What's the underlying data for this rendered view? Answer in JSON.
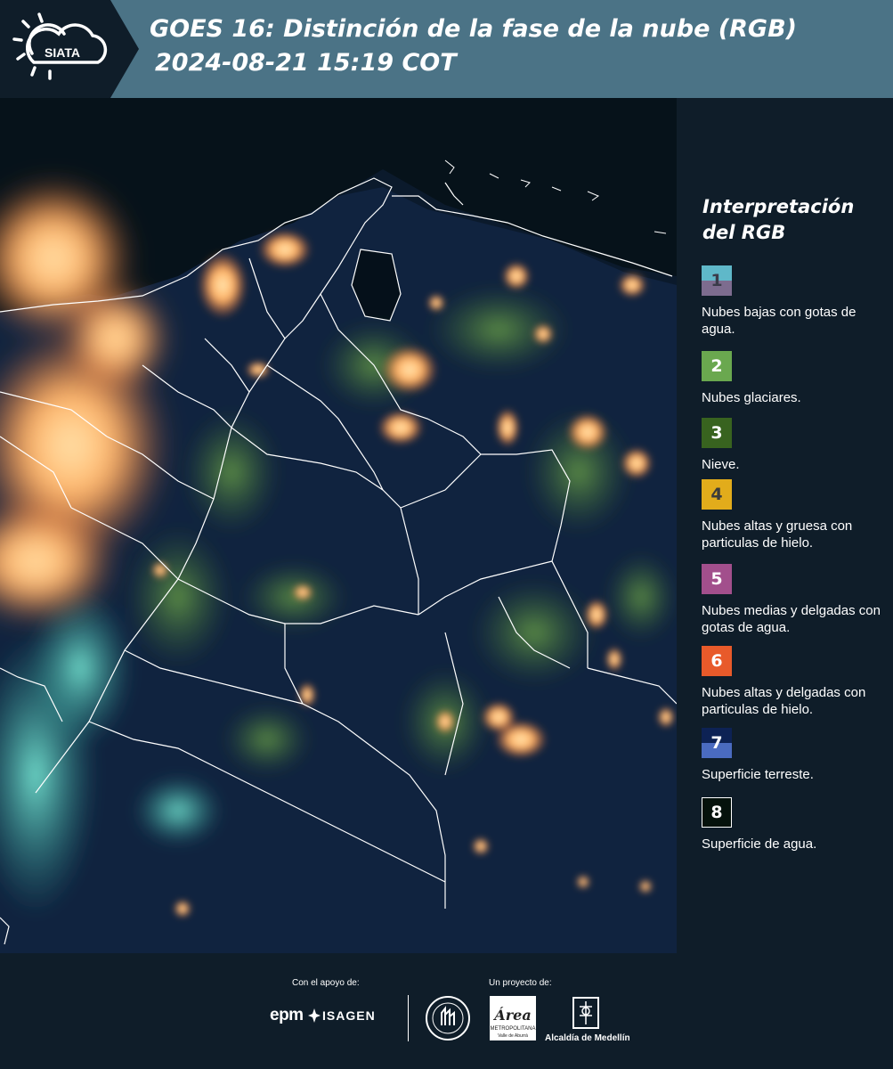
{
  "header": {
    "logo_text": "SIATA",
    "title_line1": "GOES 16: Distinción de la fase de la nube (RGB)",
    "title_line2": "2024-08-21 15:19 COT"
  },
  "legend": {
    "title_line1": "Interpretación",
    "title_line2": "del RGB",
    "items": [
      {
        "number": "1",
        "label": "Nubes bajas con gotas de agua.",
        "color_top": "#5fb8c9",
        "color_bottom": "#7d6c8f",
        "text_color": "#3b3b4a"
      },
      {
        "number": "2",
        "label": "Nubes glaciares.",
        "color_top": "#6aa84f",
        "color_bottom": "#6aa84f",
        "text_color": "#ffffff"
      },
      {
        "number": "3",
        "label": "Nieve.",
        "color_top": "#38631f",
        "color_bottom": "#38631f",
        "text_color": "#ffffff"
      },
      {
        "number": "4",
        "label": "Nubes altas y gruesa con particulas de hielo.",
        "color_top": "#e2ac1b",
        "color_bottom": "#e2ac1b",
        "text_color": "#3b3b3b"
      },
      {
        "number": "5",
        "label": "Nubes medias y delgadas con gotas de agua.",
        "color_top": "#a24f8c",
        "color_bottom": "#a24f8c",
        "text_color": "#ffffff"
      },
      {
        "number": "6",
        "label": "Nubes altas y delgadas con particulas de hielo.",
        "color_top": "#e85a2a",
        "color_bottom": "#e85a2a",
        "text_color": "#ffffff"
      },
      {
        "number": "7",
        "label": "Superficie terreste.",
        "color_top": "#0d2254",
        "color_bottom": "#4a6bc0",
        "text_color": "#ffffff"
      },
      {
        "number": "8",
        "label": "Superficie de agua.",
        "color_top": "#05120c",
        "color_bottom": "#05120c",
        "text_color": "#ffffff"
      }
    ]
  },
  "footer": {
    "support_caption": "Con el apoyo de:",
    "project_caption": "Un proyecto de:",
    "sponsor_epm": "epm",
    "sponsor_isagen": "ISAGEN",
    "partner_area_line1": "Área",
    "partner_area_line2": "METROPOLITANA",
    "partner_area_line3": "Valle de Aburrá",
    "partner_medellin": "Alcaldía de Medellín"
  }
}
